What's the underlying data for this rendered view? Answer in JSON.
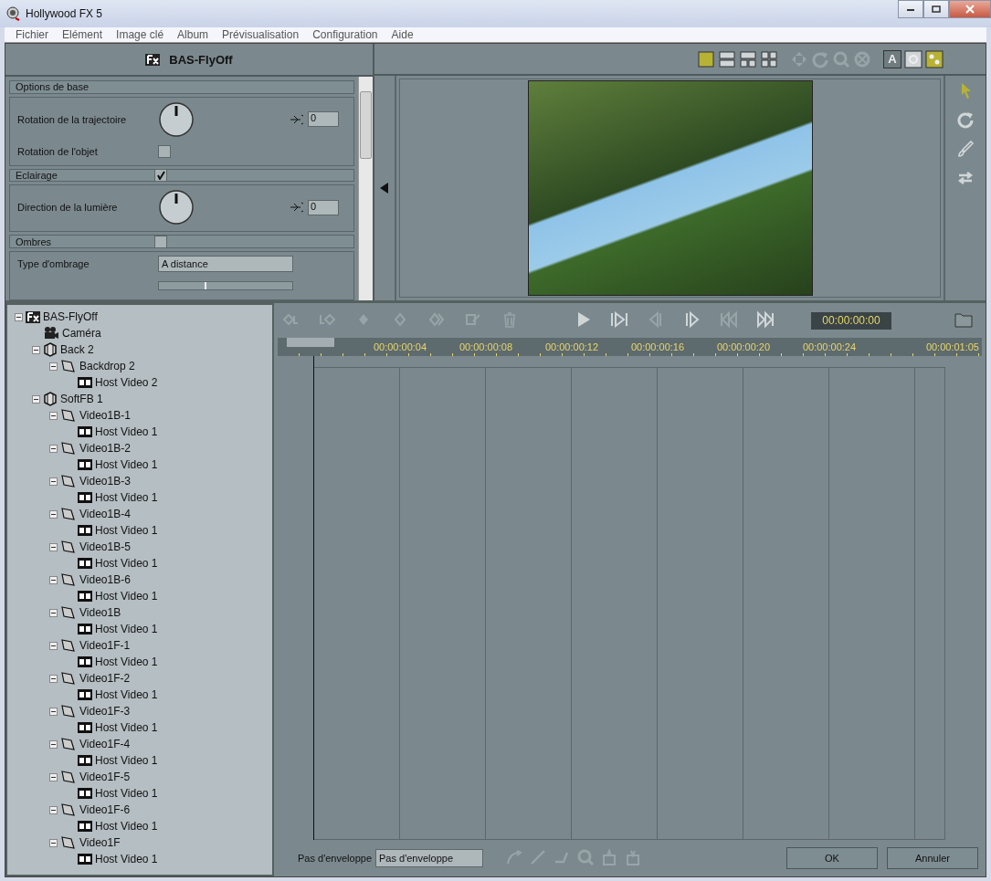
{
  "window": {
    "title": "Hollywood FX 5"
  },
  "menu": [
    "Fichier",
    "Elément",
    "Image clé",
    "Album",
    "Prévisualisation",
    "Configuration",
    "Aide"
  ],
  "effect_panel": {
    "title": "BAS-FlyOff",
    "groups": [
      {
        "title": "Options de base",
        "rows": [
          {
            "kind": "dial",
            "label": "Rotation de la trajectoire",
            "value": "0"
          },
          {
            "kind": "checkbox",
            "label": "Rotation de l'objet",
            "checked": false
          }
        ]
      },
      {
        "title": "Eclairage",
        "checked": true,
        "rows": [
          {
            "kind": "dial",
            "label": "Direction de la lumière",
            "value": "0"
          }
        ]
      },
      {
        "title": "Ombres",
        "checked": false,
        "rows": [
          {
            "kind": "dropdown",
            "label": "Type d'ombrage",
            "value": "A distance"
          },
          {
            "kind": "slider",
            "level": 0.34
          }
        ]
      }
    ]
  },
  "preview_toolbar": [
    {
      "kind": "layout-single",
      "selected": true,
      "disabled": false
    },
    {
      "kind": "layout-rows",
      "selected": false,
      "disabled": false
    },
    {
      "kind": "layout-split",
      "selected": false,
      "disabled": false
    },
    {
      "kind": "layout-grid",
      "selected": false,
      "disabled": false
    },
    {
      "kind": "move",
      "disabled": true
    },
    {
      "kind": "rotate",
      "disabled": true
    },
    {
      "kind": "zoom",
      "disabled": true
    },
    {
      "kind": "pan",
      "disabled": true
    },
    {
      "kind": "text",
      "label": "A",
      "selected": false,
      "disabled": false
    },
    {
      "kind": "circle",
      "selected": false,
      "disabled": false
    },
    {
      "kind": "dots",
      "selected": true,
      "disabled": false
    }
  ],
  "tools": [
    {
      "kind": "pointer",
      "selected": true
    },
    {
      "kind": "rotate",
      "selected": false
    },
    {
      "kind": "brush",
      "selected": false
    },
    {
      "kind": "swap",
      "selected": false
    }
  ],
  "tree": [
    {
      "label": "BAS-FlyOff",
      "kind": "fx",
      "expanded": true,
      "children": [
        {
          "label": "Caméra",
          "kind": "camera"
        },
        {
          "label": "Back 2",
          "kind": "object",
          "expanded": true,
          "children": [
            {
              "label": "Backdrop 2",
              "kind": "surface",
              "expanded": true,
              "children": [
                {
                  "label": "Host Video 2",
                  "kind": "video"
                }
              ]
            }
          ]
        },
        {
          "label": "SoftFB 1",
          "kind": "object",
          "expanded": true,
          "children": [
            {
              "label": "Video1B-1",
              "kind": "surface",
              "expanded": true,
              "children": [
                {
                  "label": "Host Video 1",
                  "kind": "video"
                }
              ]
            },
            {
              "label": "Video1B-2",
              "kind": "surface",
              "expanded": true,
              "children": [
                {
                  "label": "Host Video 1",
                  "kind": "video"
                }
              ]
            },
            {
              "label": "Video1B-3",
              "kind": "surface",
              "expanded": true,
              "children": [
                {
                  "label": "Host Video 1",
                  "kind": "video"
                }
              ]
            },
            {
              "label": "Video1B-4",
              "kind": "surface",
              "expanded": true,
              "children": [
                {
                  "label": "Host Video 1",
                  "kind": "video"
                }
              ]
            },
            {
              "label": "Video1B-5",
              "kind": "surface",
              "expanded": true,
              "children": [
                {
                  "label": "Host Video 1",
                  "kind": "video"
                }
              ]
            },
            {
              "label": "Video1B-6",
              "kind": "surface",
              "expanded": true,
              "children": [
                {
                  "label": "Host Video 1",
                  "kind": "video"
                }
              ]
            },
            {
              "label": "Video1B",
              "kind": "surface",
              "expanded": true,
              "children": [
                {
                  "label": "Host Video 1",
                  "kind": "video"
                }
              ]
            },
            {
              "label": "Video1F-1",
              "kind": "surface",
              "expanded": true,
              "children": [
                {
                  "label": "Host Video 1",
                  "kind": "video"
                }
              ]
            },
            {
              "label": "Video1F-2",
              "kind": "surface",
              "expanded": true,
              "children": [
                {
                  "label": "Host Video 1",
                  "kind": "video"
                }
              ]
            },
            {
              "label": "Video1F-3",
              "kind": "surface",
              "expanded": true,
              "children": [
                {
                  "label": "Host Video 1",
                  "kind": "video"
                }
              ]
            },
            {
              "label": "Video1F-4",
              "kind": "surface",
              "expanded": true,
              "children": [
                {
                  "label": "Host Video 1",
                  "kind": "video"
                }
              ]
            },
            {
              "label": "Video1F-5",
              "kind": "surface",
              "expanded": true,
              "children": [
                {
                  "label": "Host Video 1",
                  "kind": "video"
                }
              ]
            },
            {
              "label": "Video1F-6",
              "kind": "surface",
              "expanded": true,
              "children": [
                {
                  "label": "Host Video 1",
                  "kind": "video"
                }
              ]
            },
            {
              "label": "Video1F",
              "kind": "surface",
              "expanded": true,
              "children": [
                {
                  "label": "Host Video 1",
                  "kind": "video"
                }
              ]
            }
          ]
        }
      ]
    }
  ],
  "timeline": {
    "toolbar": [
      {
        "kind": "key-in",
        "disabled": true
      },
      {
        "kind": "key-out",
        "disabled": true
      },
      {
        "kind": "key",
        "disabled": true
      },
      {
        "kind": "key-empty",
        "disabled": true
      },
      {
        "kind": "key-swap",
        "disabled": true
      },
      {
        "kind": "key-edit",
        "disabled": true
      },
      {
        "kind": "trash",
        "disabled": true
      },
      {
        "kind": "play",
        "disabled": false
      },
      {
        "kind": "next-key",
        "disabled": false
      },
      {
        "kind": "prev-frame",
        "disabled": true
      },
      {
        "kind": "next-frame",
        "disabled": false
      },
      {
        "kind": "first",
        "disabled": true
      },
      {
        "kind": "last",
        "disabled": false
      }
    ],
    "timecode": "00:00:00:00",
    "ruler": [
      "00:00:00:04",
      "00:00:00:08",
      "00:00:00:12",
      "00:00:00:16",
      "00:00:00:20",
      "00:00:00:24"
    ],
    "ruler_end": "00:00:01:05",
    "envelope_label": "Pas d'enveloppe",
    "envelope_value": "Pas d'enveloppe",
    "curve_tools": [
      {
        "kind": "curve",
        "disabled": true
      },
      {
        "kind": "line",
        "disabled": true
      },
      {
        "kind": "step",
        "disabled": true
      },
      {
        "kind": "zoom",
        "disabled": true
      },
      {
        "kind": "paste-up",
        "disabled": true
      },
      {
        "kind": "paste-down",
        "disabled": true
      }
    ],
    "buttons": [
      "OK",
      "Annuler"
    ]
  }
}
